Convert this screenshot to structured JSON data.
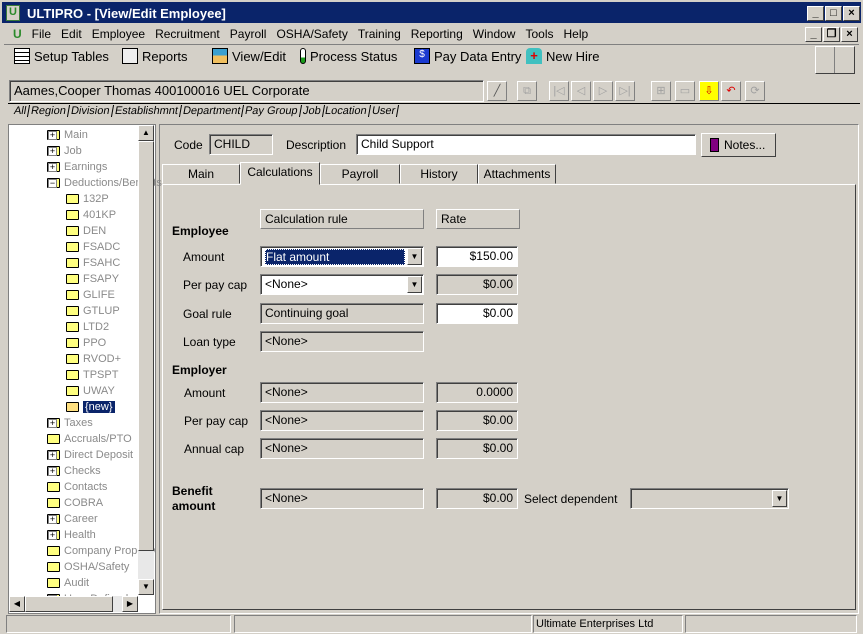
{
  "window": {
    "title": "ULTIPRO - [View/Edit Employee]"
  },
  "menu": [
    "File",
    "Edit",
    "Employee",
    "Recruitment",
    "Payroll",
    "OSHA/Safety",
    "Training",
    "Reporting",
    "Window",
    "Tools",
    "Help"
  ],
  "toolbar": {
    "setup_tables": "Setup Tables",
    "reports": "Reports",
    "view_edit": "View/Edit",
    "process_status": "Process Status",
    "pay_data_entry": "Pay Data Entry",
    "new_hire": "New Hire"
  },
  "employee_bar": {
    "value": "Aames,Cooper Thomas 400100016  UEL Corporate"
  },
  "filter_tabs": [
    "All",
    "Region",
    "Division",
    "Establishmnt",
    "Department",
    "Pay Group",
    "Job",
    "Location",
    "User"
  ],
  "tree": {
    "top": [
      {
        "label": "Main",
        "expand": true
      },
      {
        "label": "Job",
        "expand": true
      },
      {
        "label": "Earnings",
        "expand": true
      },
      {
        "label": "Deductions/Benefits",
        "expand": "open"
      }
    ],
    "children": [
      "132P",
      "401KP",
      "DEN",
      "FSADC",
      "FSAHC",
      "FSAPY",
      "GLIFE",
      "GTLUP",
      "LTD2",
      "PPO",
      "RVOD+",
      "TPSPT",
      "UWAY"
    ],
    "selected": "{new}",
    "bottom": [
      {
        "label": "Taxes",
        "expand": true
      },
      {
        "label": "Accruals/PTO",
        "expand": false
      },
      {
        "label": "Direct Deposit",
        "expand": true
      },
      {
        "label": "Checks",
        "expand": true
      },
      {
        "label": "Contacts",
        "expand": false
      },
      {
        "label": "COBRA",
        "expand": false
      },
      {
        "label": "Career",
        "expand": true
      },
      {
        "label": "Health",
        "expand": true
      },
      {
        "label": "Company Property",
        "expand": false
      },
      {
        "label": "OSHA/Safety",
        "expand": false
      },
      {
        "label": "Audit",
        "expand": false
      },
      {
        "label": "User Defined",
        "expand": true
      }
    ]
  },
  "header": {
    "code_label": "Code",
    "code_value": "CHILD",
    "description_label": "Description",
    "description_value": "Child Support",
    "notes": "Notes..."
  },
  "tabs": [
    "Main",
    "Calculations",
    "Payroll",
    "History",
    "Attachments"
  ],
  "active_tab": "Calculations",
  "calc": {
    "col_rule": "Calculation rule",
    "col_rate": "Rate",
    "employee_heading": "Employee",
    "employee": [
      {
        "label": "Amount",
        "rule": "Flat amount",
        "rate": "$150.00",
        "dropdown": true,
        "editable": true,
        "selected": true
      },
      {
        "label": "Per pay cap",
        "rule": "<None>",
        "rate": "$0.00",
        "dropdown": true,
        "editable": false
      },
      {
        "label": "Goal rule",
        "rule": "Continuing goal",
        "rate": "$0.00",
        "dropdown": false,
        "editable": true
      },
      {
        "label": "Loan type",
        "rule": "<None>",
        "dropdown": false
      }
    ],
    "employer_heading": "Employer",
    "employer": [
      {
        "label": "Amount",
        "rule": "<None>",
        "rate": "0.0000"
      },
      {
        "label": "Per pay cap",
        "rule": "<None>",
        "rate": "$0.00"
      },
      {
        "label": "Annual cap",
        "rule": "<None>",
        "rate": "$0.00"
      }
    ],
    "benefit_label_1": "Benefit",
    "benefit_label_2": "amount",
    "benefit_rule": "<None>",
    "benefit_rate": "$0.00",
    "select_dependent_label": "Select dependent",
    "select_dependent_value": ""
  },
  "status_bar": {
    "company": "Ultimate Enterprises Ltd"
  }
}
